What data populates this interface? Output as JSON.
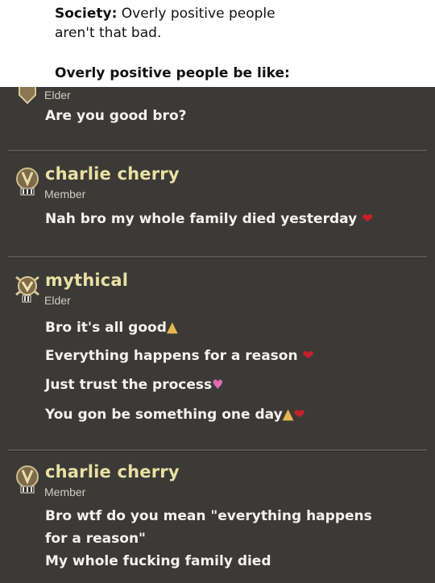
{
  "caption": {
    "line1_bold": "Society:",
    "line1_rest": " Overly positive  people",
    "line2": "aren't that bad.",
    "line3": "Overly  positive  people be like:"
  },
  "chat": {
    "top_role": "Elder",
    "top_message": "Are you good bro?",
    "posts": [
      {
        "username": "charlie cherry",
        "role": "Member",
        "messages": [
          "Nah bro my whole family died yesterday"
        ]
      },
      {
        "username": "mythical",
        "role": "Elder",
        "messages": [
          "Bro it's all good",
          "Everything happens for a reason",
          "Just trust the process",
          "You gon be something one day"
        ]
      },
      {
        "username": "charlie cherry",
        "role": "Member",
        "messages": [
          "Bro wtf do you mean \"everything happens",
          "for a reason\"",
          "My whole fucking family died"
        ]
      }
    ]
  },
  "colors": {
    "chat_bg": "#3b3a37",
    "username": "#e9e0a3",
    "message": "#f4f2ee",
    "role": "#cfcbc1"
  },
  "icons": {
    "member_badge": "member-rank-badge-icon",
    "elder_badge": "elder-rank-badge-icon",
    "pray": "folded-hands-emoji",
    "red_heart": "red-heart-emoji",
    "broken_heart": "broken-heart-emoji",
    "pink_hearts": "two-hearts-emoji"
  }
}
